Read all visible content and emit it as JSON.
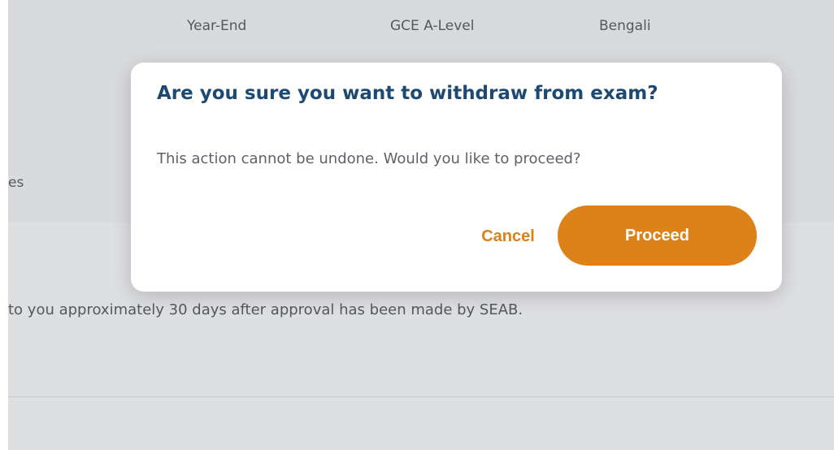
{
  "background": {
    "exam_row": {
      "session": "Year-End",
      "level": "GCE A-Level",
      "subject": "Bengali",
      "truncated_cell": "es"
    },
    "info_text": "to you approximately 30 days after approval has been made by SEAB."
  },
  "dialog": {
    "title": "Are you sure you want to withdraw from exam?",
    "message": "This action cannot be undone. Would you like to proceed?",
    "cancel_label": "Cancel",
    "proceed_label": "Proceed"
  },
  "colors": {
    "accent": "#dc8219",
    "title": "#1e4a72",
    "overlay": "#dedfe1"
  }
}
